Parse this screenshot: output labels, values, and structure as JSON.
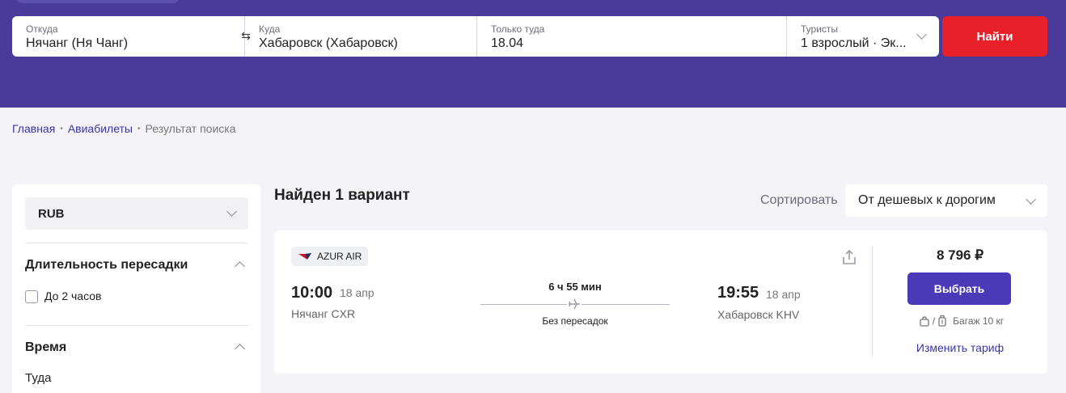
{
  "search": {
    "from_label": "Откуда",
    "from_value": "Нячанг (Ня Чанг)",
    "to_label": "Куда",
    "to_value": "Хабаровск (Хабаровск)",
    "date_label": "Только туда",
    "date_value": "18.04",
    "tourists_label": "Туристы",
    "tourists_value": "1 взрослый · Эк...",
    "search_button": "Найти"
  },
  "breadcrumb": {
    "home": "Главная",
    "tickets": "Авиабилеты",
    "current": "Результат поиска"
  },
  "sidebar": {
    "currency": "RUB",
    "transfer_title": "Длительность пересадки",
    "transfer_option": "До 2 часов",
    "time_title": "Время",
    "time_sub": "Туда"
  },
  "results": {
    "title": "Найден 1 вариант",
    "sort_label": "Сортировать",
    "sort_value": "От дешевых к дорогим"
  },
  "flight": {
    "airline": "AZUR AIR",
    "dep_time": "10:00",
    "dep_date": "18 апр",
    "dep_city": "Нячанг CXR",
    "duration": "6 ч 55 мин",
    "stops": "Без пересадок",
    "arr_time": "19:55",
    "arr_date": "18 апр",
    "arr_city": "Хабаровск KHV",
    "price": "8 796 ₽",
    "select_button": "Выбрать",
    "slash": "/",
    "baggage": "Багаж 10 кг",
    "change_tariff": "Изменить тариф"
  },
  "icons": {
    "swap": "swap-icon",
    "chevron": "chevron-down-icon",
    "plane": "plane-icon",
    "share": "share-icon",
    "bag": "bag-icon",
    "luggage": "luggage-icon"
  },
  "colors": {
    "header": "#4a3a99",
    "search_button": "#e8202a",
    "select_button": "#4a3ab8",
    "link": "#3a34a8"
  }
}
